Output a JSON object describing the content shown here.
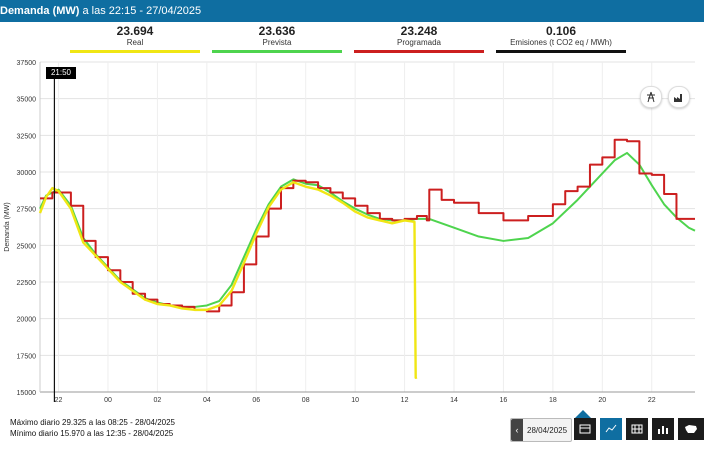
{
  "header": {
    "title_bold": "Demanda (MW)",
    "title_rest": " a las 22:15 - 27/04/2025"
  },
  "stats": [
    {
      "value": "23.694",
      "label": "Real",
      "color": "#f0e614"
    },
    {
      "value": "23.636",
      "label": "Prevista",
      "color": "#4ed44e"
    },
    {
      "value": "23.248",
      "label": "Programada",
      "color": "#cc1f1f"
    },
    {
      "value": "0.106",
      "label": "Emisiones (t CO2 eq / MWh)",
      "color": "#111111"
    }
  ],
  "cursor_label": "21:50",
  "info": {
    "max": "Máximo diario 29.325 a las 08:25 - 28/04/2025",
    "min": "Mínimo diario 15.970 a las 12:35 - 28/04/2025"
  },
  "toolbar": {
    "date": "28/04/2025",
    "prev_arrow": "‹"
  },
  "icons": {
    "top_right": [
      "tower-icon",
      "factory-icon"
    ],
    "bottom": [
      "table-view-icon",
      "chart-view-icon",
      "grid-view-icon",
      "bars-view-icon",
      "spain-map-icon"
    ]
  },
  "chart_data": {
    "type": "line",
    "ylabel": "Demanda (MW)",
    "ylim": [
      15000,
      37500
    ],
    "yticks": [
      15000,
      17500,
      20000,
      22500,
      25000,
      27500,
      30000,
      32500,
      35000,
      37500
    ],
    "xticks": [
      "22",
      "00",
      "02",
      "04",
      "06",
      "08",
      "10",
      "12",
      "14",
      "16",
      "18",
      "20",
      "22"
    ],
    "xtick_hours": [
      22,
      24,
      26,
      28,
      30,
      32,
      34,
      36,
      38,
      40,
      42,
      44,
      46
    ],
    "xlim_hours": [
      21.25,
      47.75
    ],
    "cursor_hour": 21.833,
    "grid": true,
    "series": [
      {
        "name": "Real",
        "color": "#f0e614",
        "x": [
          21.25,
          21.5,
          21.75,
          22,
          22.5,
          23,
          23.5,
          24,
          24.5,
          25,
          25.5,
          26,
          26.5,
          27,
          27.5,
          28,
          28.5,
          29,
          29.5,
          30,
          30.5,
          31,
          31.5,
          32,
          32.5,
          33,
          33.5,
          34,
          34.5,
          35,
          35.5,
          36,
          36.4,
          36.45,
          36.5
        ],
        "y": [
          27200,
          28300,
          28900,
          28700,
          27500,
          25200,
          24300,
          23400,
          22500,
          21900,
          21300,
          21000,
          20900,
          20700,
          20600,
          20600,
          20900,
          21900,
          23800,
          25800,
          27600,
          28800,
          29300,
          29000,
          28800,
          28400,
          27900,
          27300,
          26900,
          26700,
          26500,
          26700,
          26600,
          15970,
          16000
        ]
      },
      {
        "name": "Prevista",
        "color": "#4ed44e",
        "x": [
          21.25,
          21.5,
          22,
          22.5,
          23,
          23.5,
          24,
          24.5,
          25,
          25.5,
          26,
          26.5,
          27,
          27.5,
          28,
          28.5,
          29,
          29.5,
          30,
          30.5,
          31,
          31.5,
          32,
          32.5,
          33,
          33.5,
          34,
          34.5,
          35,
          35.5,
          36,
          36.5,
          37,
          38,
          39,
          40,
          41,
          42,
          43,
          44,
          44.5,
          45,
          45.5,
          46,
          46.5,
          47,
          47.5,
          47.75
        ],
        "y": [
          27500,
          28400,
          28800,
          27700,
          25500,
          24400,
          23500,
          22600,
          22000,
          21400,
          21100,
          20900,
          20800,
          20800,
          20900,
          21200,
          22300,
          24200,
          26100,
          27800,
          29000,
          29500,
          29200,
          29100,
          28600,
          28000,
          27500,
          27100,
          26800,
          26700,
          26700,
          26800,
          26800,
          26200,
          25600,
          25300,
          25500,
          26500,
          28100,
          29900,
          30800,
          31300,
          30500,
          29100,
          27800,
          26900,
          26200,
          26000
        ]
      },
      {
        "name": "Programada",
        "color": "#cc1f1f",
        "step": true,
        "x": [
          21.25,
          21.75,
          22.5,
          23,
          23.5,
          24,
          24.5,
          25,
          25.5,
          26,
          26.5,
          27,
          27.5,
          28,
          28.5,
          29,
          29.5,
          30,
          30.5,
          31,
          31.5,
          32,
          32.5,
          33,
          33.5,
          34,
          34.5,
          35,
          35.5,
          36,
          36.5,
          36.9,
          37,
          37.5,
          38,
          39,
          40,
          41,
          42,
          42.5,
          43,
          43.5,
          44,
          44.5,
          45,
          45.5,
          46,
          46.5,
          47,
          47.75
        ],
        "y": [
          28200,
          28600,
          27700,
          25300,
          24200,
          23300,
          22500,
          21700,
          21300,
          21000,
          20900,
          20800,
          20600,
          20500,
          20900,
          21800,
          23700,
          25600,
          27500,
          28900,
          29400,
          29300,
          28900,
          28600,
          28200,
          27700,
          27200,
          26800,
          26700,
          26800,
          27000,
          26700,
          28800,
          28100,
          27900,
          27200,
          26700,
          27000,
          27800,
          28700,
          29000,
          30500,
          31000,
          32200,
          32100,
          29900,
          29800,
          28500,
          26800,
          26800
        ]
      }
    ]
  }
}
